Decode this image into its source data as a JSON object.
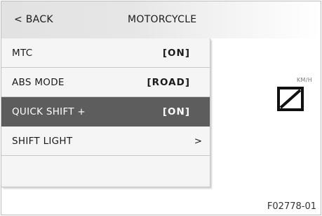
{
  "header": {
    "back_label": "< BACK",
    "title": "MOTORCYCLE"
  },
  "menu": {
    "items": [
      {
        "label": "MTC",
        "value": "[ON]",
        "selected": false
      },
      {
        "label": "ABS MODE",
        "value": "[ROAD]",
        "selected": false
      },
      {
        "label": "QUICK SHIFT +",
        "value": "[ON]",
        "selected": true
      },
      {
        "label": "SHIFT LIGHT",
        "value": ">",
        "selected": false
      }
    ]
  },
  "speed": {
    "unit": "KM/H",
    "icon": "crossed-box-icon"
  },
  "figure_code": "F02778-01",
  "colors": {
    "selected_row": "#5d5d5d",
    "menu_bg": "#f5f5f5",
    "header_bg": "#e4e4e4"
  }
}
